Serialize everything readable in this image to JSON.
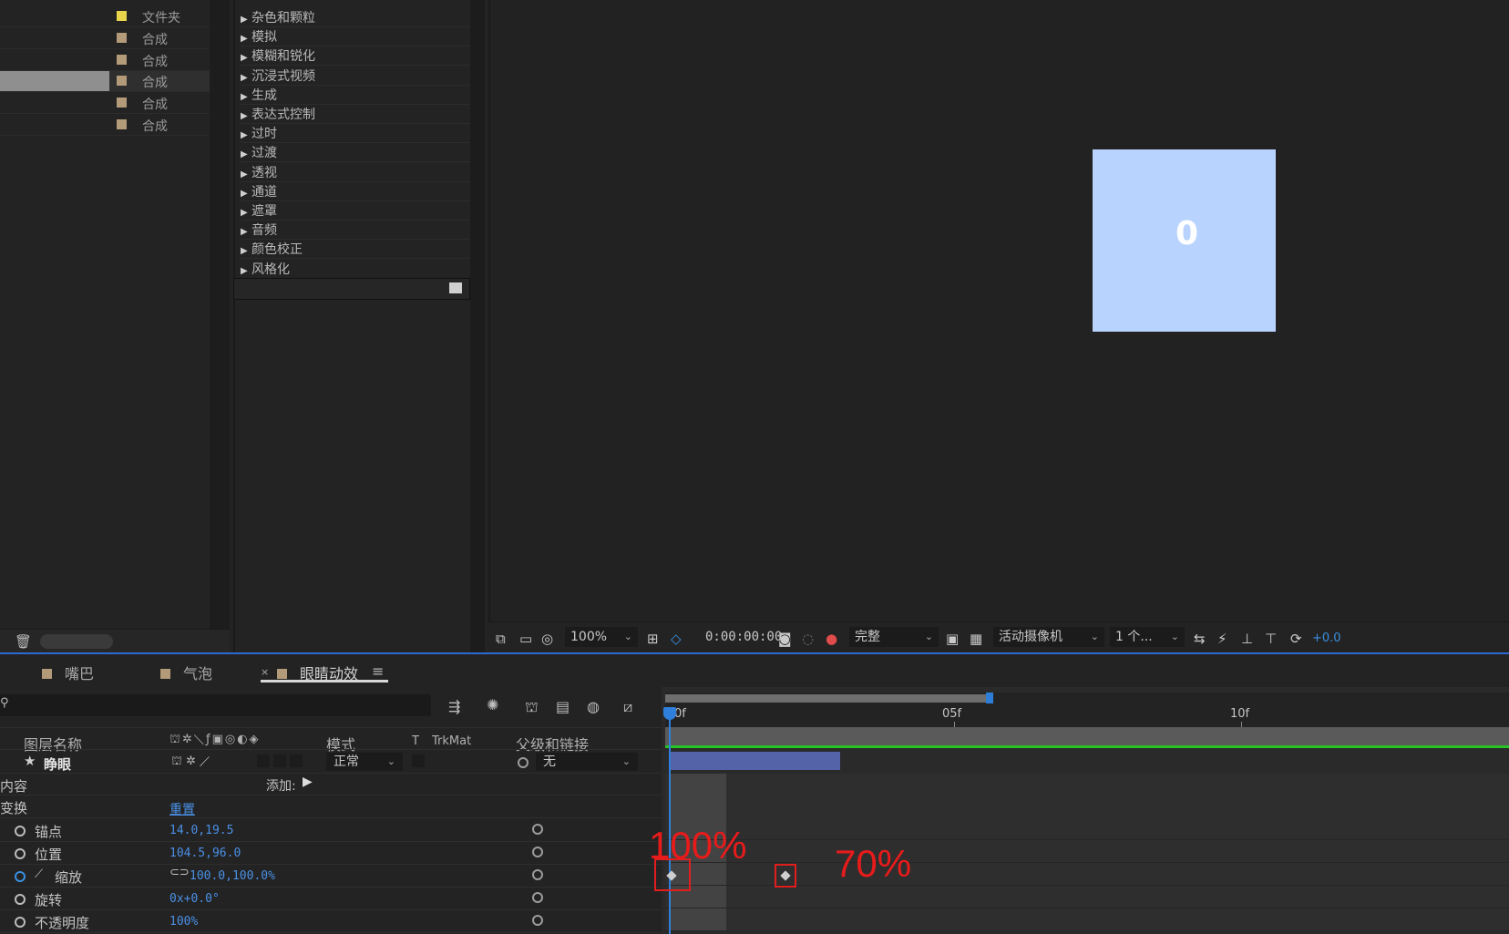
{
  "project": {
    "items": [
      {
        "type": "文件夹",
        "color": "#e8d54c"
      },
      {
        "type": "合成",
        "color": "#b39a78"
      },
      {
        "type": "合成",
        "color": "#b39a78"
      },
      {
        "type": "合成",
        "color": "#b39a78"
      },
      {
        "type": "合成",
        "color": "#b39a78"
      },
      {
        "type": "合成",
        "color": "#b39a78"
      }
    ]
  },
  "effects": {
    "categories": [
      "杂色和颗粒",
      "模拟",
      "模糊和锐化",
      "沉浸式视频",
      "生成",
      "表达式控制",
      "过时",
      "过渡",
      "透视",
      "通道",
      "遮罩",
      "音频",
      "颜色校正",
      "风格化"
    ]
  },
  "viewer": {
    "canvas_color": "#b9d3ff",
    "canvas_text": "0",
    "zoom": "100%",
    "timecode": "0:00:00:00",
    "resolution": "完整",
    "camera": "活动摄像机",
    "views": "1 个...",
    "exposure": "+0.0"
  },
  "timeline": {
    "tabs": [
      "嘴巴",
      "气泡",
      "眼睛动效"
    ],
    "active_tab_index": 2,
    "columns": {
      "layer_name": "图层名称",
      "mode": "模式",
      "t": "T",
      "trkmat": "TrkMat",
      "parent": "父级和链接"
    },
    "layer": {
      "name": "睁眼",
      "mode": "正常",
      "parent": "无"
    },
    "contents_label": "内容",
    "add_label": "添加:",
    "transform_label": "变换",
    "reset_label": "重置",
    "properties": [
      {
        "name": "锚点",
        "value": "14.0,19.5"
      },
      {
        "name": "位置",
        "value": "104.5,96.0"
      },
      {
        "name": "缩放",
        "value": "100.0,100.0%"
      },
      {
        "name": "旋转",
        "value": "0x+0.0°"
      },
      {
        "name": "不透明度",
        "value": "100%"
      }
    ],
    "ruler_labels": [
      "0f",
      "05f",
      "10f"
    ],
    "annotations": {
      "first": "100%",
      "second": "70%"
    }
  }
}
